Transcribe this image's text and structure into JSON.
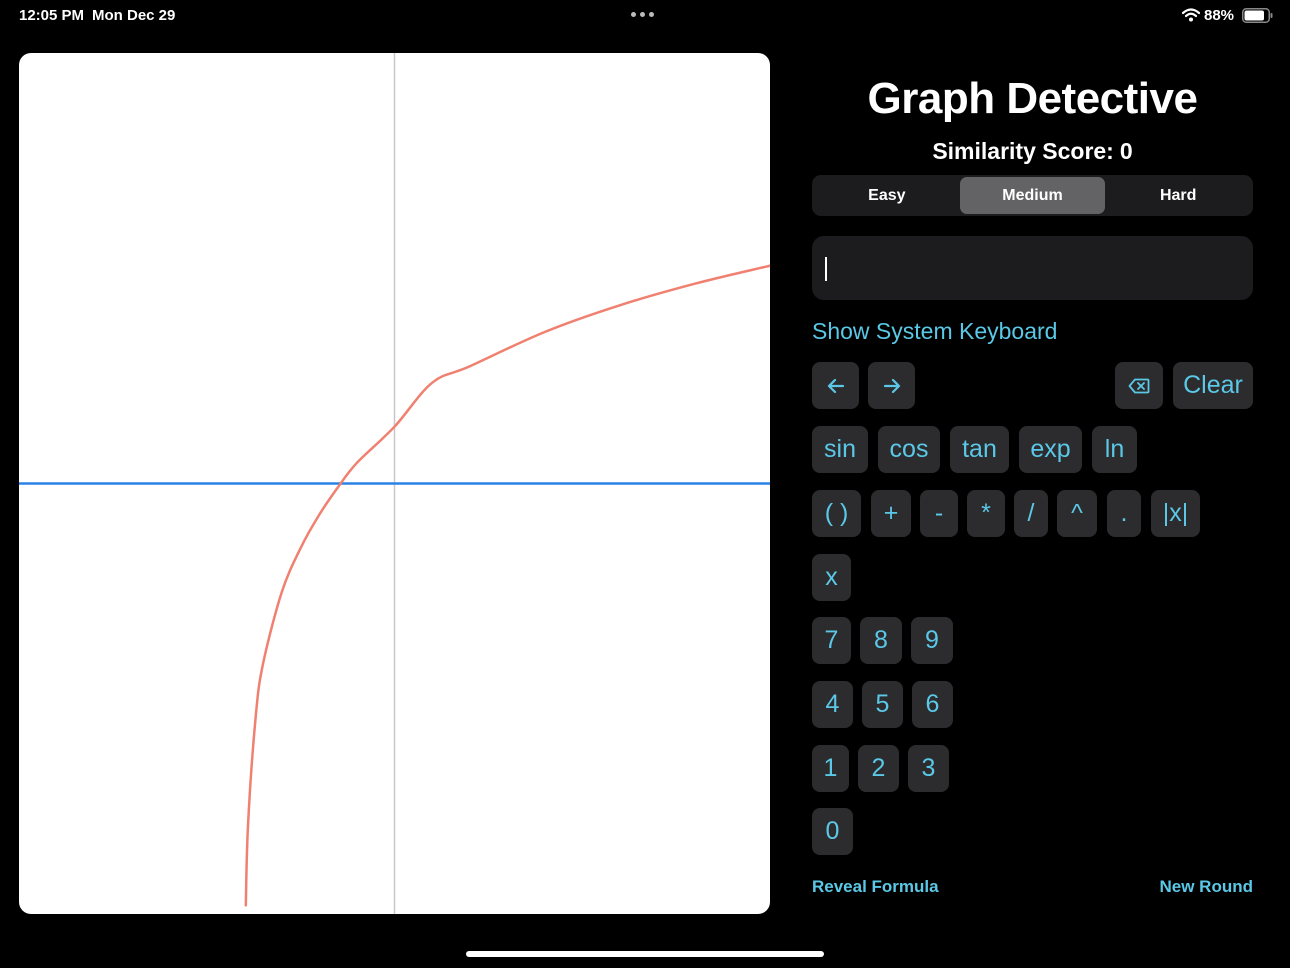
{
  "status_bar": {
    "time": "12:05 PM",
    "date": "Mon Dec 29",
    "battery": "88%",
    "icons": [
      "multitasking-dots-icon",
      "wifi-icon",
      "battery-icon"
    ]
  },
  "header": {
    "title": "Graph Detective",
    "score_label": "Similarity Score:",
    "score_value": "0"
  },
  "difficulty": {
    "options": [
      "Easy",
      "Medium",
      "Hard"
    ],
    "selected": "Medium"
  },
  "formula_input": {
    "value": ""
  },
  "show_keyboard_label": "Show System Keyboard",
  "keypad": {
    "nav": {
      "left_icon": "arrow-left-icon",
      "right_icon": "arrow-right-icon",
      "delete_icon": "delete-backward-icon",
      "clear": "Clear"
    },
    "functions": [
      "sin",
      "cos",
      "tan",
      "exp",
      "ln"
    ],
    "operators": [
      "( )",
      "+",
      "-",
      "*",
      "/",
      "^",
      ".",
      "|x|"
    ],
    "variable": "x",
    "digits_row1": [
      "7",
      "8",
      "9"
    ],
    "digits_row2": [
      "4",
      "5",
      "6"
    ],
    "digits_row3": [
      "1",
      "2",
      "3"
    ],
    "digits_row4": [
      "0"
    ]
  },
  "footer": {
    "reveal": "Reveal Formula",
    "new_round": "New Round"
  },
  "colors": {
    "accent": "#5ac8e6",
    "curve": "#f08070",
    "x_axis": "#2a82e4",
    "y_axis": "#c8c8c8",
    "active_segment": "#636366",
    "key_background": "#2c2c2e"
  },
  "chart_data": {
    "type": "line",
    "title": "",
    "xlabel": "",
    "ylabel": "",
    "grid": false,
    "xlim": [
      -10,
      10
    ],
    "ylim": [
      -5,
      5
    ],
    "series": [
      {
        "x": [
          -3.96,
          -3.9,
          -3.7,
          -3.5,
          -3.0,
          -2.5,
          -2.0,
          -1.5,
          -1.0,
          0.0,
          1.0,
          2.0,
          4.0,
          6.0,
          8.0,
          10.0
        ],
        "values": [
          -4.9,
          -3.95,
          -2.72,
          -2.09,
          -1.26,
          -0.75,
          -0.36,
          -0.04,
          0.24,
          0.66,
          1.17,
          1.36,
          1.76,
          2.07,
          2.32,
          2.53
        ]
      }
    ]
  }
}
